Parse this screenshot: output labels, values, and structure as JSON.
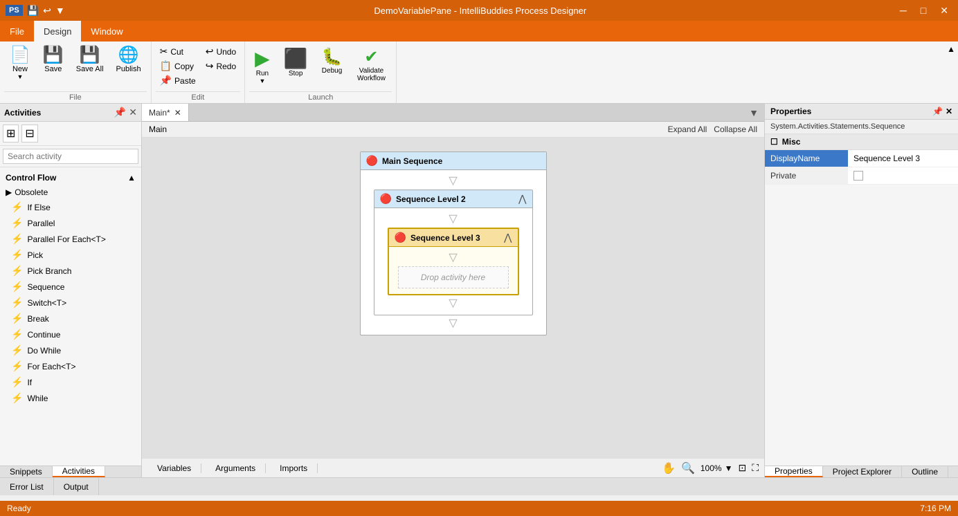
{
  "titleBar": {
    "title": "DemoVariablePane - IntelliBuddies Process Designer",
    "icon": "PS",
    "minBtn": "─",
    "maxBtn": "□",
    "closeBtn": "✕"
  },
  "menuBar": {
    "items": [
      {
        "id": "file",
        "label": "File"
      },
      {
        "id": "design",
        "label": "Design",
        "active": true
      },
      {
        "id": "window",
        "label": "Window"
      }
    ]
  },
  "ribbon": {
    "groups": [
      {
        "id": "file",
        "label": "File",
        "buttons": [
          {
            "id": "new",
            "label": "New",
            "icon": "📄"
          },
          {
            "id": "save",
            "label": "Save",
            "icon": "💾"
          },
          {
            "id": "save-all",
            "label": "Save All",
            "icon": "💾"
          },
          {
            "id": "publish",
            "label": "Publish",
            "icon": "🌐"
          }
        ]
      },
      {
        "id": "edit",
        "label": "Edit",
        "smallButtons": [
          {
            "id": "cut",
            "label": "Cut",
            "icon": "✂"
          },
          {
            "id": "undo",
            "label": "Undo",
            "icon": "↩"
          },
          {
            "id": "copy",
            "label": "Copy",
            "icon": "📋"
          },
          {
            "id": "redo",
            "label": "Redo",
            "icon": "↪"
          },
          {
            "id": "paste",
            "label": "Paste",
            "icon": "📌"
          }
        ]
      },
      {
        "id": "launch",
        "label": "Launch",
        "buttons": [
          {
            "id": "run",
            "label": "Run",
            "icon": "▶",
            "color": "#3a3"
          },
          {
            "id": "stop",
            "label": "Stop",
            "icon": "⬛",
            "color": "#888"
          },
          {
            "id": "debug",
            "label": "Debug",
            "icon": "🐛",
            "color": "#c44"
          },
          {
            "id": "validate",
            "label": "Validate Workflow",
            "icon": "✔",
            "color": "#3a3"
          }
        ]
      }
    ]
  },
  "activitiesPanel": {
    "title": "Activities",
    "searchPlaceholder": "Search activity",
    "sections": [
      {
        "id": "control-flow",
        "label": "Control Flow",
        "expanded": true,
        "items": [
          {
            "id": "obsolete",
            "label": "Obsolete",
            "icon": "▶",
            "subsection": true
          },
          {
            "id": "if-else",
            "label": "If Else",
            "icon": "⚡"
          },
          {
            "id": "parallel",
            "label": "Parallel",
            "icon": "⚡"
          },
          {
            "id": "parallel-foreach",
            "label": "Parallel For Each<T>",
            "icon": "⚡"
          },
          {
            "id": "pick",
            "label": "Pick",
            "icon": "⚡"
          },
          {
            "id": "pick-branch",
            "label": "Pick Branch",
            "icon": "⚡"
          },
          {
            "id": "sequence",
            "label": "Sequence",
            "icon": "⚡"
          },
          {
            "id": "switch",
            "label": "Switch<T>",
            "icon": "⚡"
          },
          {
            "id": "break",
            "label": "Break",
            "icon": "⚡"
          },
          {
            "id": "continue",
            "label": "Continue",
            "icon": "⚡"
          },
          {
            "id": "do-while",
            "label": "Do While",
            "icon": "⚡"
          },
          {
            "id": "for-each",
            "label": "For Each<T>",
            "icon": "⚡"
          },
          {
            "id": "if",
            "label": "If",
            "icon": "⚡"
          },
          {
            "id": "while",
            "label": "While",
            "icon": "⚡"
          }
        ]
      }
    ],
    "bottomTabs": [
      {
        "id": "snippets",
        "label": "Snippets"
      },
      {
        "id": "activities",
        "label": "Activities",
        "active": true
      }
    ]
  },
  "designer": {
    "tabLabel": "Main*",
    "breadcrumb": "Main",
    "expandAll": "Expand All",
    "collapseAll": "Collapse All",
    "sequences": {
      "main": {
        "title": "Main Sequence",
        "level": 1,
        "children": [
          {
            "title": "Sequence Level 2",
            "level": 2,
            "children": [
              {
                "title": "Sequence Level 3",
                "level": 3,
                "dropText": "Drop activity here"
              }
            ]
          }
        ]
      }
    },
    "bottomTabs": [
      {
        "id": "variables",
        "label": "Variables"
      },
      {
        "id": "arguments",
        "label": "Arguments"
      },
      {
        "id": "imports",
        "label": "Imports"
      }
    ],
    "zoom": "100%"
  },
  "propertiesPanel": {
    "title": "Properties",
    "subtitle": "System.Activities.Statements.Sequence",
    "section": "Misc",
    "rows": [
      {
        "key": "DisplayName",
        "value": "Sequence Level 3",
        "highlighted": true
      },
      {
        "key": "Private",
        "value": "",
        "checkbox": true
      }
    ],
    "bottomTabs": [
      {
        "id": "properties",
        "label": "Properties",
        "active": true
      },
      {
        "id": "project-explorer",
        "label": "Project Explorer"
      },
      {
        "id": "outline",
        "label": "Outline"
      }
    ]
  },
  "statusBar": {
    "text": "Ready",
    "time": "7:16 PM"
  },
  "errorOutputBar": {
    "tabs": [
      {
        "id": "error-list",
        "label": "Error List"
      },
      {
        "id": "output",
        "label": "Output"
      }
    ]
  }
}
